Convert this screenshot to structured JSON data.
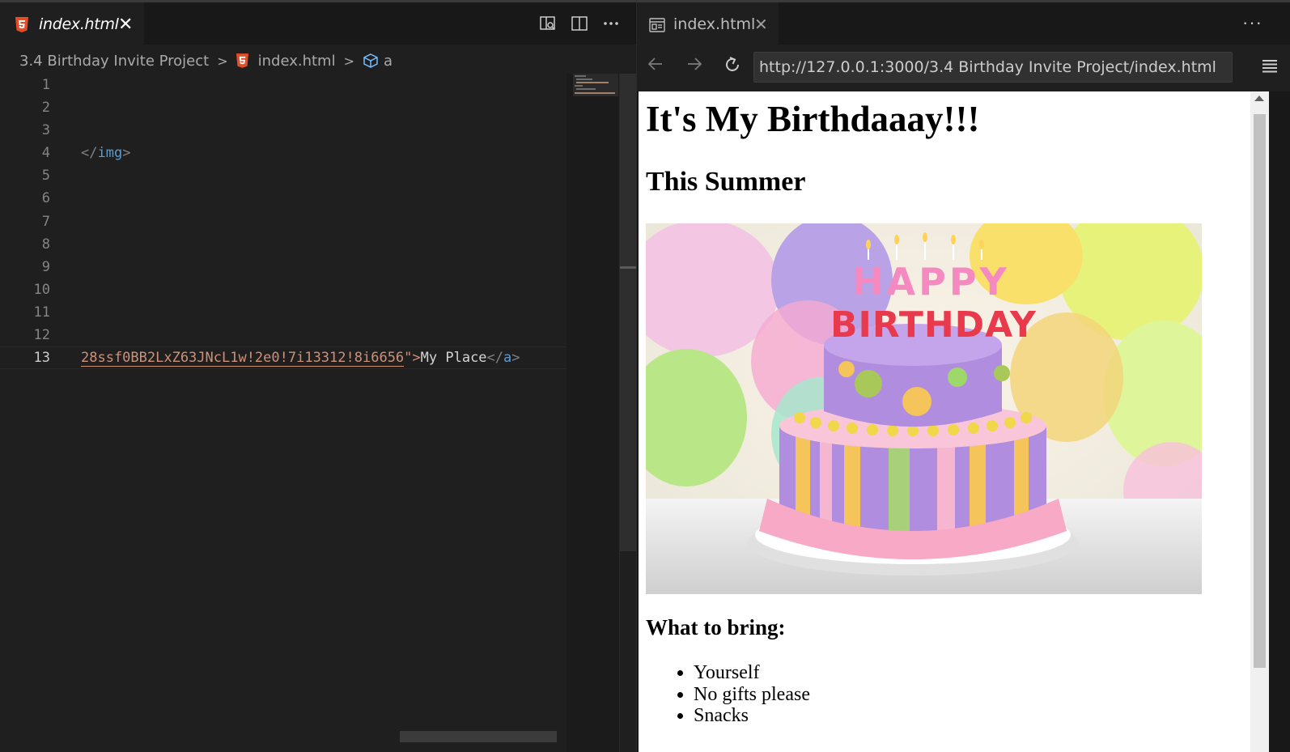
{
  "editor": {
    "tab": {
      "label": "index.html",
      "close": "✕"
    },
    "actions": [
      "open-preview-icon",
      "split-editor-icon",
      "more-actions-icon"
    ],
    "breadcrumb": {
      "folder": "3.4 Birthday Invite Project",
      "file": "index.html",
      "symbol": "a"
    },
    "line_numbers": [
      "1",
      "2",
      "3",
      "4",
      "5",
      "6",
      "7",
      "8",
      "9",
      "10",
      "11",
      "12",
      "13"
    ],
    "active_line": 13,
    "code": {
      "line4_close_open": "</",
      "line4_tag": "img",
      "line4_close_end": ">",
      "line13_string": "28ssf0BB2LxZ63JNcL1w!2e0!7i13312!8i6656",
      "line13_quote": "\">",
      "line13_text": "My Place",
      "line13_tag_open": "</",
      "line13_tag": "a",
      "line13_tag_end": ">"
    }
  },
  "browser": {
    "tab": {
      "label": "index.html",
      "close": "✕"
    },
    "more": "···",
    "url": "http://127.0.0.1:3000/3.4 Birthday Invite Project/index.html",
    "page": {
      "h1": "It's My Birthdaaay!!!",
      "h2": "This Summer",
      "h3": "What to bring:",
      "items": [
        "Yourself",
        "No gifts please",
        "Snacks"
      ],
      "cake_letters_top": "HAPPY",
      "cake_letters_bottom": "BIRTHDAY"
    }
  },
  "colors": {
    "editor_bg": "#1f1f1f",
    "tag": "#569cd6",
    "string": "#ce9178",
    "html5_icon": "#e44d26"
  }
}
